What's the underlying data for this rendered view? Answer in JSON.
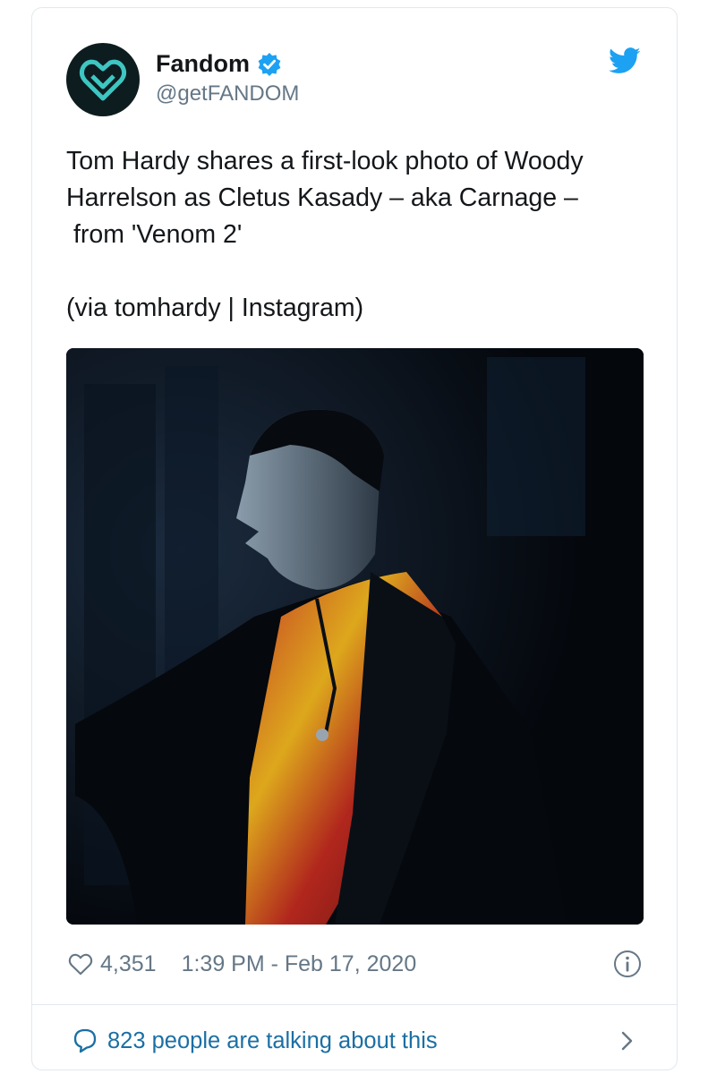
{
  "tweet": {
    "display_name": "Fandom",
    "handle": "@getFANDOM",
    "verified": true,
    "text_lines": [
      "Tom Hardy shares a first-look photo of Woody",
      "Harrelson as Cletus Kasady – aka Carnage –",
      " from 'Venom 2'"
    ],
    "via_line": "(via tomhardy | Instagram)",
    "likes": "4,351",
    "timestamp": "1:39 PM - Feb 17, 2020",
    "talking_label": "823 people are talking about this"
  },
  "icons": {
    "avatar": "fandom-heart-logo",
    "verified": "verified-badge-icon",
    "bird": "twitter-bird-icon",
    "like": "heart-outline-icon",
    "info": "info-icon",
    "reply": "speech-bubble-icon",
    "chevron": "chevron-right-icon"
  },
  "colors": {
    "twitter_blue": "#1da1f2",
    "link_blue": "#1b6fa3",
    "muted_text": "#657786",
    "avatar_bg": "#0d1c1f",
    "logo_teal": "#3ec6c2"
  }
}
